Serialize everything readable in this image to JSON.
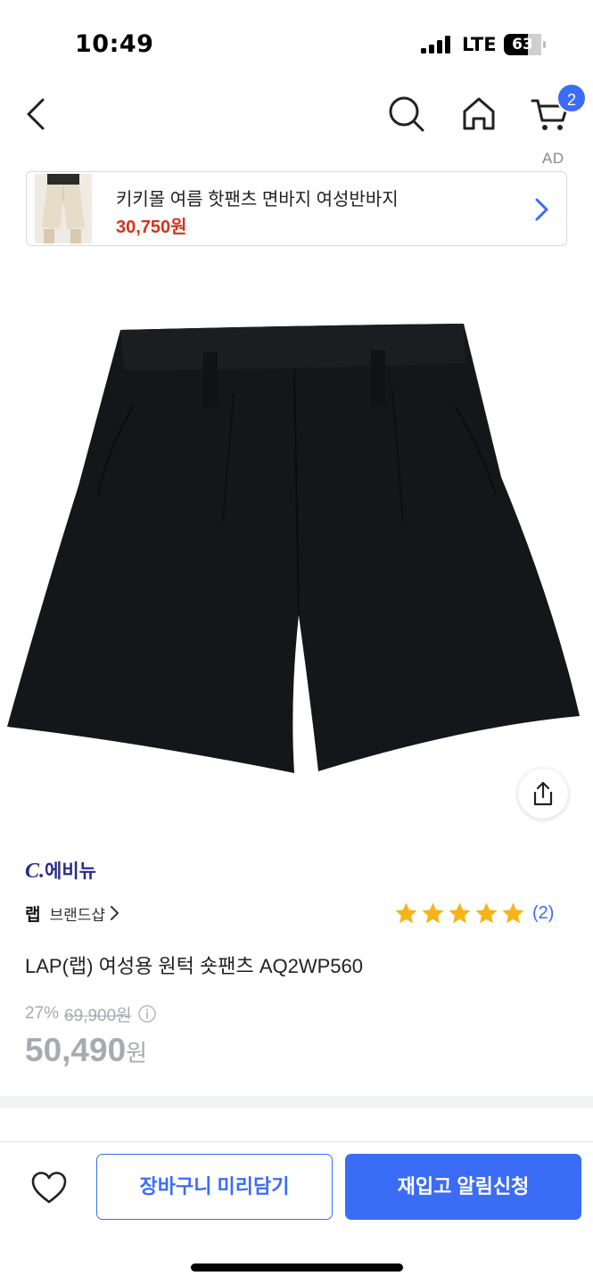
{
  "status_bar": {
    "time": "10:49",
    "network": "LTE",
    "battery": "63"
  },
  "nav": {
    "cart_count": "2"
  },
  "ad": {
    "label": "AD",
    "title": "키키몰 여름 핫팬츠 면바지 여성반바지",
    "price": "30,750원"
  },
  "product": {
    "mall_logo_c": "C.",
    "mall_logo_name": "에비뉴",
    "brand": "랩",
    "brand_shop": "브랜드샵",
    "rating_count": "(2)",
    "rating_stars": 5,
    "title": "LAP(랩) 여성용 원턱 숏팬츠 AQ2WP560",
    "discount_rate": "27%",
    "original_price": "69,900원",
    "sale_price": "50,490",
    "sale_price_unit": "원"
  },
  "bottom_bar": {
    "cart_button": "장바구니 미리담기",
    "restock_button": "재입고 알림신청"
  },
  "colors": {
    "accent": "#3b6cf6",
    "ad_price": "#d8321d",
    "muted_price": "#a7aab0",
    "mall_logo": "#2a2d85",
    "star": "#f6b418"
  },
  "icons": [
    "back-icon",
    "search-icon",
    "home-icon",
    "cart-icon",
    "chevron-right-icon",
    "share-icon",
    "star-icon",
    "info-icon",
    "heart-icon"
  ]
}
